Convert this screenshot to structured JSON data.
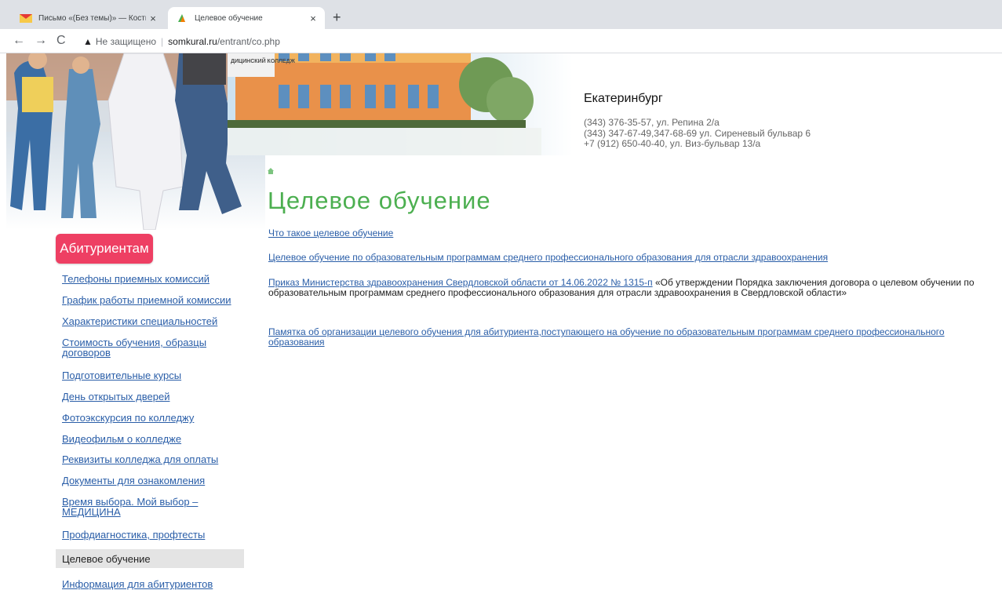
{
  "browser": {
    "tabs": [
      {
        "title": "Письмо «(Без темы)» — Костылева",
        "active": false
      },
      {
        "title": "Целевое обучение",
        "active": true
      }
    ],
    "new_tab_label": "+",
    "tab_close_glyph": "×",
    "address": {
      "security_label": "Не защищено",
      "host": "somkural.ru",
      "path": "/entrant/co.php"
    }
  },
  "header": {
    "logo_text": "ДИЦИНСКИЙ КОЛЛЕДЖ",
    "city": "Екатеринбург",
    "contacts": [
      "(343) 376-35-57, ул. Репина 2/а",
      "(343) 347-67-49,347-68-69 ул. Сиреневый бульвар 6",
      "+7 (912) 650-40-40, ул. Виз-бульвар 13/а"
    ]
  },
  "breadcrumb": {
    "home_icon": "home-icon"
  },
  "page_title": "Целевое обучение",
  "content": {
    "link1": "Что такое целевое обучение",
    "link2": "Целевое обучение по образовательным программам среднего профессионального образования для отрасли здравоохранения",
    "link3": "Приказ Министерства здравоохранения Свердловской области от 14.06.2022 № 1315-п",
    "text3": " «Об утверждении Порядка заключения договора о целевом обучении по образовательным программам среднего профессионального образования для отрасли здравоохранения в Свердловской области»",
    "link4": "Памятка об организации целевого обучения для абитуриента,поступающего на обучение по образовательным программам среднего профессионального  образования"
  },
  "sidebar": {
    "title": "Абитуриентам",
    "items": [
      {
        "label": "Телефоны приемных комиссий"
      },
      {
        "label": "График работы приемной комиссии"
      },
      {
        "label": "Характеристики специальностей"
      },
      {
        "label": "Стоимость обучения, образцы договоров"
      },
      {
        "label": "Подготовительные курсы"
      },
      {
        "label": "День открытых дверей"
      },
      {
        "label": "Фотоэкскурсия по колледжу"
      },
      {
        "label": "Видеофильм о колледже"
      },
      {
        "label": "Реквизиты колледжа для оплаты"
      },
      {
        "label": "Документы для ознакомления"
      },
      {
        "label": "Время выбора. Мой выбор – МЕДИЦИНА"
      },
      {
        "label": "Профдиагностика, профтесты"
      },
      {
        "label": "Целевое обучение",
        "active": true
      },
      {
        "label": "Информация для абитуриентов"
      }
    ]
  },
  "colors": {
    "title_green": "#4caf50",
    "link_blue": "#2a5ea8",
    "badge_pink": "#ee3f63",
    "active_item_bg": "#e4e4e4"
  }
}
